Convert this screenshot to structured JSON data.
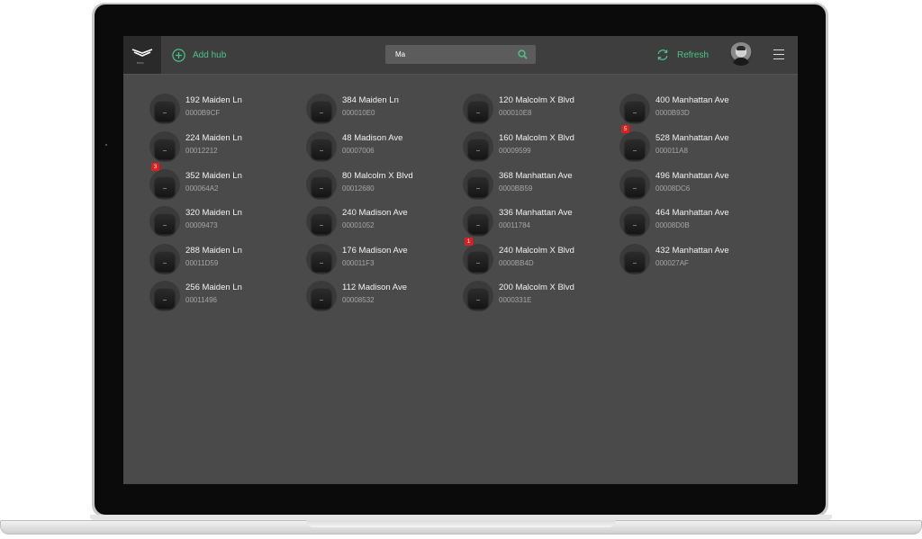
{
  "header": {
    "add_hub_label": "Add hub",
    "search_value": "Ma",
    "refresh_label": "Refresh",
    "logo_sub": "PRO"
  },
  "colors": {
    "accent": "#4cc38a",
    "badge": "#e01e1e",
    "background": "#4a4a4a",
    "topbar": "#3e3e3e"
  },
  "icons": {
    "add": "plus-circle-icon",
    "search": "search-icon",
    "refresh": "refresh-icon",
    "menu": "hamburger-menu-icon"
  },
  "hubs": [
    {
      "name": "192 Maiden Ln",
      "id": "0000B9CF",
      "col": 0,
      "row": 0,
      "badge": ""
    },
    {
      "name": "384 Maiden Ln",
      "id": "000010E0",
      "col": 1,
      "row": 0,
      "badge": ""
    },
    {
      "name": "120 Malcolm X Blvd",
      "id": "000010E8",
      "col": 2,
      "row": 0,
      "badge": ""
    },
    {
      "name": "400 Manhattan Ave",
      "id": "0000B93D",
      "col": 3,
      "row": 0,
      "badge": ""
    },
    {
      "name": "224 Maiden Ln",
      "id": "00012212",
      "col": 0,
      "row": 1,
      "badge": ""
    },
    {
      "name": "48 Madison Ave",
      "id": "00007006",
      "col": 1,
      "row": 1,
      "badge": ""
    },
    {
      "name": "160 Malcolm X Blvd",
      "id": "00009599",
      "col": 2,
      "row": 1,
      "badge": ""
    },
    {
      "name": "528 Manhattan Ave",
      "id": "000011A8",
      "col": 3,
      "row": 1,
      "badge": "5"
    },
    {
      "name": "352 Maiden Ln",
      "id": "000064A2",
      "col": 0,
      "row": 2,
      "badge": "3"
    },
    {
      "name": "80 Malcolm X Blvd",
      "id": "00012680",
      "col": 1,
      "row": 2,
      "badge": ""
    },
    {
      "name": "368 Manhattan Ave",
      "id": "0000BB59",
      "col": 2,
      "row": 2,
      "badge": ""
    },
    {
      "name": "496 Manhattan Ave",
      "id": "00008DC6",
      "col": 3,
      "row": 2,
      "badge": ""
    },
    {
      "name": "320 Maiden Ln",
      "id": "00009473",
      "col": 0,
      "row": 3,
      "badge": ""
    },
    {
      "name": "240 Madison Ave",
      "id": "00001052",
      "col": 1,
      "row": 3,
      "badge": ""
    },
    {
      "name": "336 Manhattan Ave",
      "id": "00011784",
      "col": 2,
      "row": 3,
      "badge": ""
    },
    {
      "name": "464 Manhattan Ave",
      "id": "00008D0B",
      "col": 3,
      "row": 3,
      "badge": ""
    },
    {
      "name": "288 Maiden Ln",
      "id": "00011D59",
      "col": 0,
      "row": 4,
      "badge": ""
    },
    {
      "name": "176 Madison Ave",
      "id": "000011F3",
      "col": 1,
      "row": 4,
      "badge": ""
    },
    {
      "name": "240 Malcolm X Blvd",
      "id": "0000BB4D",
      "col": 2,
      "row": 4,
      "badge": "1"
    },
    {
      "name": "432 Manhattan Ave",
      "id": "000027AF",
      "col": 3,
      "row": 4,
      "badge": ""
    },
    {
      "name": "256 Maiden Ln",
      "id": "00011496",
      "col": 0,
      "row": 5,
      "badge": ""
    },
    {
      "name": "112 Madison Ave",
      "id": "00008532",
      "col": 1,
      "row": 5,
      "badge": ""
    },
    {
      "name": "200 Malcolm X Blvd",
      "id": "0000331E",
      "col": 2,
      "row": 5,
      "badge": ""
    }
  ]
}
